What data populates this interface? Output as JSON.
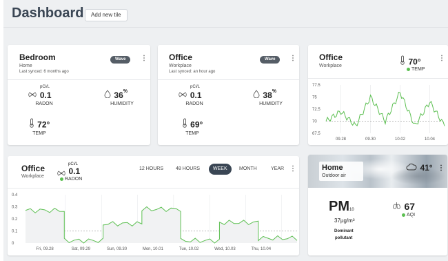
{
  "header": {
    "title": "Dashboard",
    "add_tile_label": "Add new tile"
  },
  "bedroom": {
    "title": "Bedroom",
    "location": "Home",
    "synced": "Last synced: 6 months ago",
    "badge": "Wave",
    "radon": {
      "unit": "pCi/L",
      "value": "0.1",
      "label": "RADON"
    },
    "humidity": {
      "value": "36",
      "unit": "%",
      "label": "HUMIDITY"
    },
    "temp": {
      "value": "72°",
      "label": "TEMP"
    }
  },
  "office_card": {
    "title": "Office",
    "location": "Workplace",
    "synced": "Last synced: an hour ago",
    "badge": "Wave",
    "radon": {
      "unit": "pCi/L",
      "value": "0.1",
      "label": "RADON"
    },
    "humidity": {
      "value": "38",
      "unit": "%",
      "label": "HUMIDITY"
    },
    "temp": {
      "value": "69°",
      "label": "TEMP"
    }
  },
  "office_temp_chart": {
    "title": "Office",
    "location": "Workplace",
    "value": "70°",
    "label": "TEMP",
    "y_ticks": [
      "77.5",
      "75",
      "72.5",
      "70",
      "67.5"
    ],
    "x_ticks": [
      "09.28",
      "09.30",
      "10.02",
      "10.04"
    ]
  },
  "office_radon_chart": {
    "title": "Office",
    "location": "Workplace",
    "unit": "pCi/L",
    "value": "0.1",
    "label": "RADON",
    "time_ranges": [
      "12 HOURS",
      "48 HOURS",
      "WEEK",
      "MONTH",
      "YEAR"
    ],
    "active_range": "WEEK",
    "y_ticks": [
      "0.4",
      "0.3",
      "0.2",
      "0.1",
      "0"
    ],
    "x_ticks": [
      "Fri, 09.28",
      "Sat, 09.29",
      "Sun, 09.30",
      "Mon, 10.01",
      "Tue, 10.02",
      "Wed, 10.03",
      "Thu, 10.04"
    ]
  },
  "home_card": {
    "title": "Home",
    "subtitle": "Outdoor air",
    "temp": "41°",
    "pm_label": "PM",
    "pm_sub": "10",
    "pm_value": "37µg/m³",
    "dominant": "Dominant",
    "pollutant": "pollutant",
    "aqi_value": "67",
    "aqi_label": "AQI"
  },
  "colors": {
    "accent_green": "#5bbf50",
    "header_text": "#3a4654",
    "badge_bg": "#555d66"
  },
  "chart_data": [
    {
      "type": "line",
      "x": [
        "09.27",
        "09.28",
        "09.29",
        "09.30",
        "10.01",
        "10.02",
        "10.03",
        "10.04",
        "10.05"
      ],
      "series": [
        {
          "values": [
            70,
            72,
            69,
            75,
            70,
            76,
            69,
            74,
            69
          ]
        }
      ],
      "ylim": [
        67.5,
        77.5
      ],
      "y_ticks": [
        67.5,
        70,
        72.5,
        75,
        77.5
      ],
      "x_ticks": [
        "09.28",
        "09.30",
        "10.02",
        "10.04"
      ],
      "reference_line": 70,
      "grid": true
    },
    {
      "type": "line",
      "x": [
        "Fri, 09.28",
        "Sat, 09.29",
        "Sun, 09.30",
        "Mon, 10.01",
        "Tue, 10.02",
        "Wed, 10.03",
        "Thu, 10.04"
      ],
      "series": [
        {
          "values": [
            0.27,
            0.02,
            0.16,
            0.28,
            0.02,
            0.17,
            0.04
          ]
        }
      ],
      "ylim": [
        0,
        0.4
      ],
      "y_ticks": [
        0,
        0.1,
        0.2,
        0.3,
        0.4
      ],
      "reference_line": 0.1,
      "grid": true
    }
  ]
}
